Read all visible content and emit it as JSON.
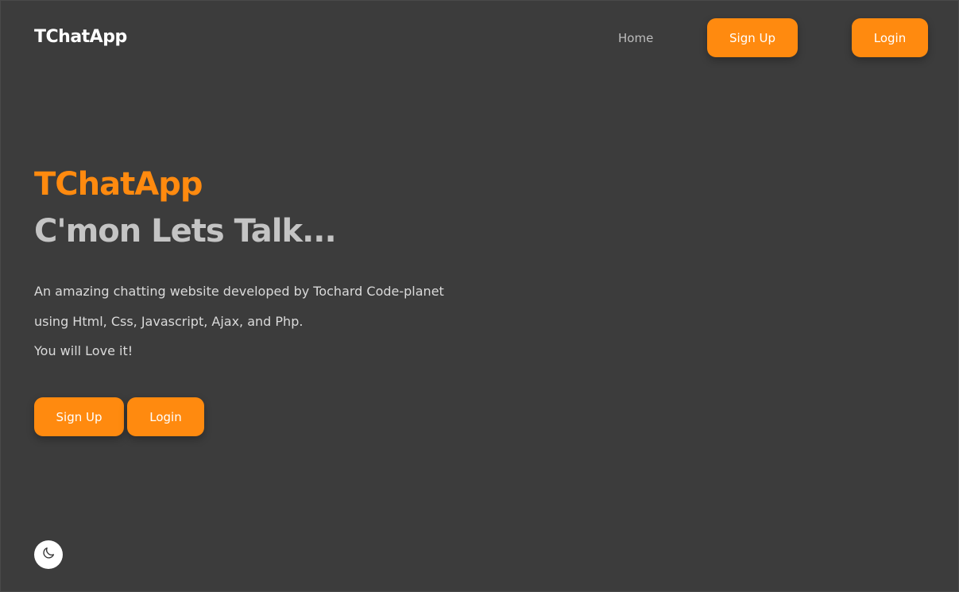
{
  "navbar": {
    "logo": "TChatApp",
    "home_label": "Home",
    "signup_label": "Sign Up",
    "login_label": "Login"
  },
  "hero": {
    "brand": "TChatApp",
    "tagline": "C'mon Lets Talk...",
    "description_lines": [
      "An amazing chatting website developed by Tochard Code-planet",
      "using Html, Css, Javascript, Ajax, and Php.",
      "You will Love it!"
    ],
    "signup_label": "Sign Up",
    "login_label": "Login"
  },
  "theme_toggle": {
    "icon": "moon-icon"
  },
  "colors": {
    "background": "#3c3c3c",
    "accent": "#ff8a0f",
    "logo_text": "#ffffff",
    "tagline_text": "#c4c4c4"
  }
}
